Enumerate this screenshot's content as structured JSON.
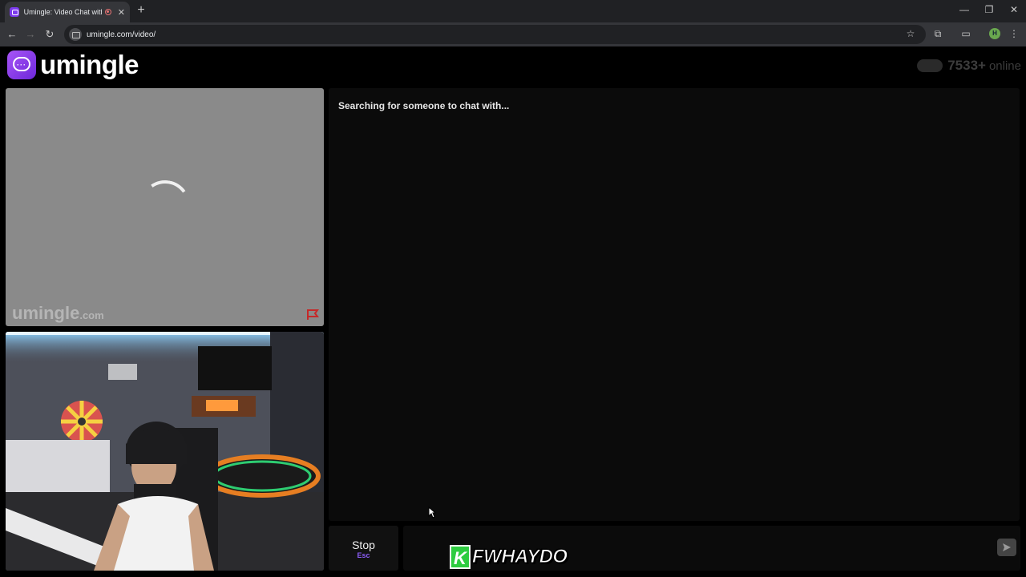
{
  "browser": {
    "tab_title": "Umingle: Video Chat with S",
    "tab_close": "✕",
    "new_tab": "+",
    "url": "umingle.com/video/",
    "profile_initial": "H",
    "window_controls": [
      "—",
      "❐",
      "✕"
    ]
  },
  "site": {
    "logo_text": "umingle",
    "online_count": "7533+",
    "online_label": "online",
    "brand_color": "#7c3aed"
  },
  "stranger_video": {
    "watermark": "umingle",
    "watermark_suffix": ".com",
    "report_icon": "flag-icon"
  },
  "chat": {
    "status": "Searching for someone to chat with...",
    "input_value": "",
    "stop_label": "Stop",
    "stop_shortcut": "Esc",
    "send_icon": "send-icon"
  },
  "overlay": {
    "streamer_badge": "K",
    "streamer_name": "FWHAYDO"
  }
}
